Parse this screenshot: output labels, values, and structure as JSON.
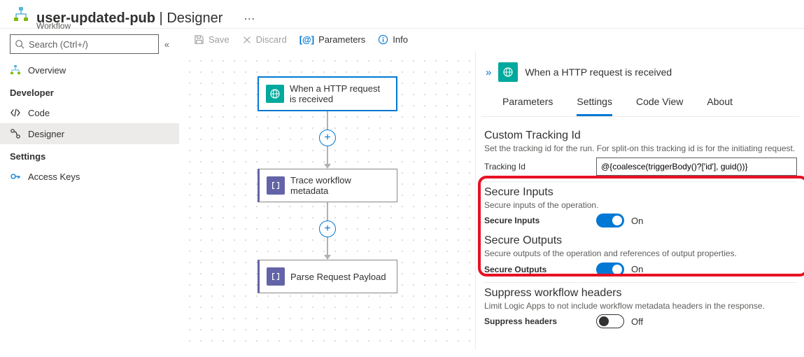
{
  "header": {
    "title_strong": "user-updated-pub",
    "title_sep": " | ",
    "title_thin": "Designer",
    "subtitle": "Workflow"
  },
  "sidebar": {
    "search_placeholder": "Search (Ctrl+/)",
    "overview": "Overview",
    "developer_heading": "Developer",
    "items": [
      {
        "label": "Code"
      },
      {
        "label": "Designer"
      }
    ],
    "settings_heading": "Settings",
    "access_keys": "Access Keys"
  },
  "toolbar": {
    "save": "Save",
    "discard": "Discard",
    "parameters": "Parameters",
    "info": "Info"
  },
  "flow": {
    "node1": "When a HTTP request is received",
    "node2": "Trace workflow metadata",
    "node3": "Parse Request Payload"
  },
  "panel": {
    "title": "When a HTTP request is received",
    "tabs": {
      "parameters": "Parameters",
      "settings": "Settings",
      "codeview": "Code View",
      "about": "About"
    },
    "tracking": {
      "title": "Custom Tracking Id",
      "desc": "Set the tracking id for the run. For split-on this tracking id is for the initiating request.",
      "label": "Tracking Id",
      "value": "@{coalesce(triggerBody()?['id'], guid())}"
    },
    "secure_inputs": {
      "title": "Secure Inputs",
      "desc": "Secure inputs of the operation.",
      "label": "Secure Inputs",
      "state": "On"
    },
    "secure_outputs": {
      "title": "Secure Outputs",
      "desc": "Secure outputs of the operation and references of output properties.",
      "label": "Secure Outputs",
      "state": "On"
    },
    "suppress": {
      "title": "Suppress workflow headers",
      "desc": "Limit Logic Apps to not include workflow metadata headers in the response.",
      "label": "Suppress headers",
      "state": "Off"
    }
  }
}
